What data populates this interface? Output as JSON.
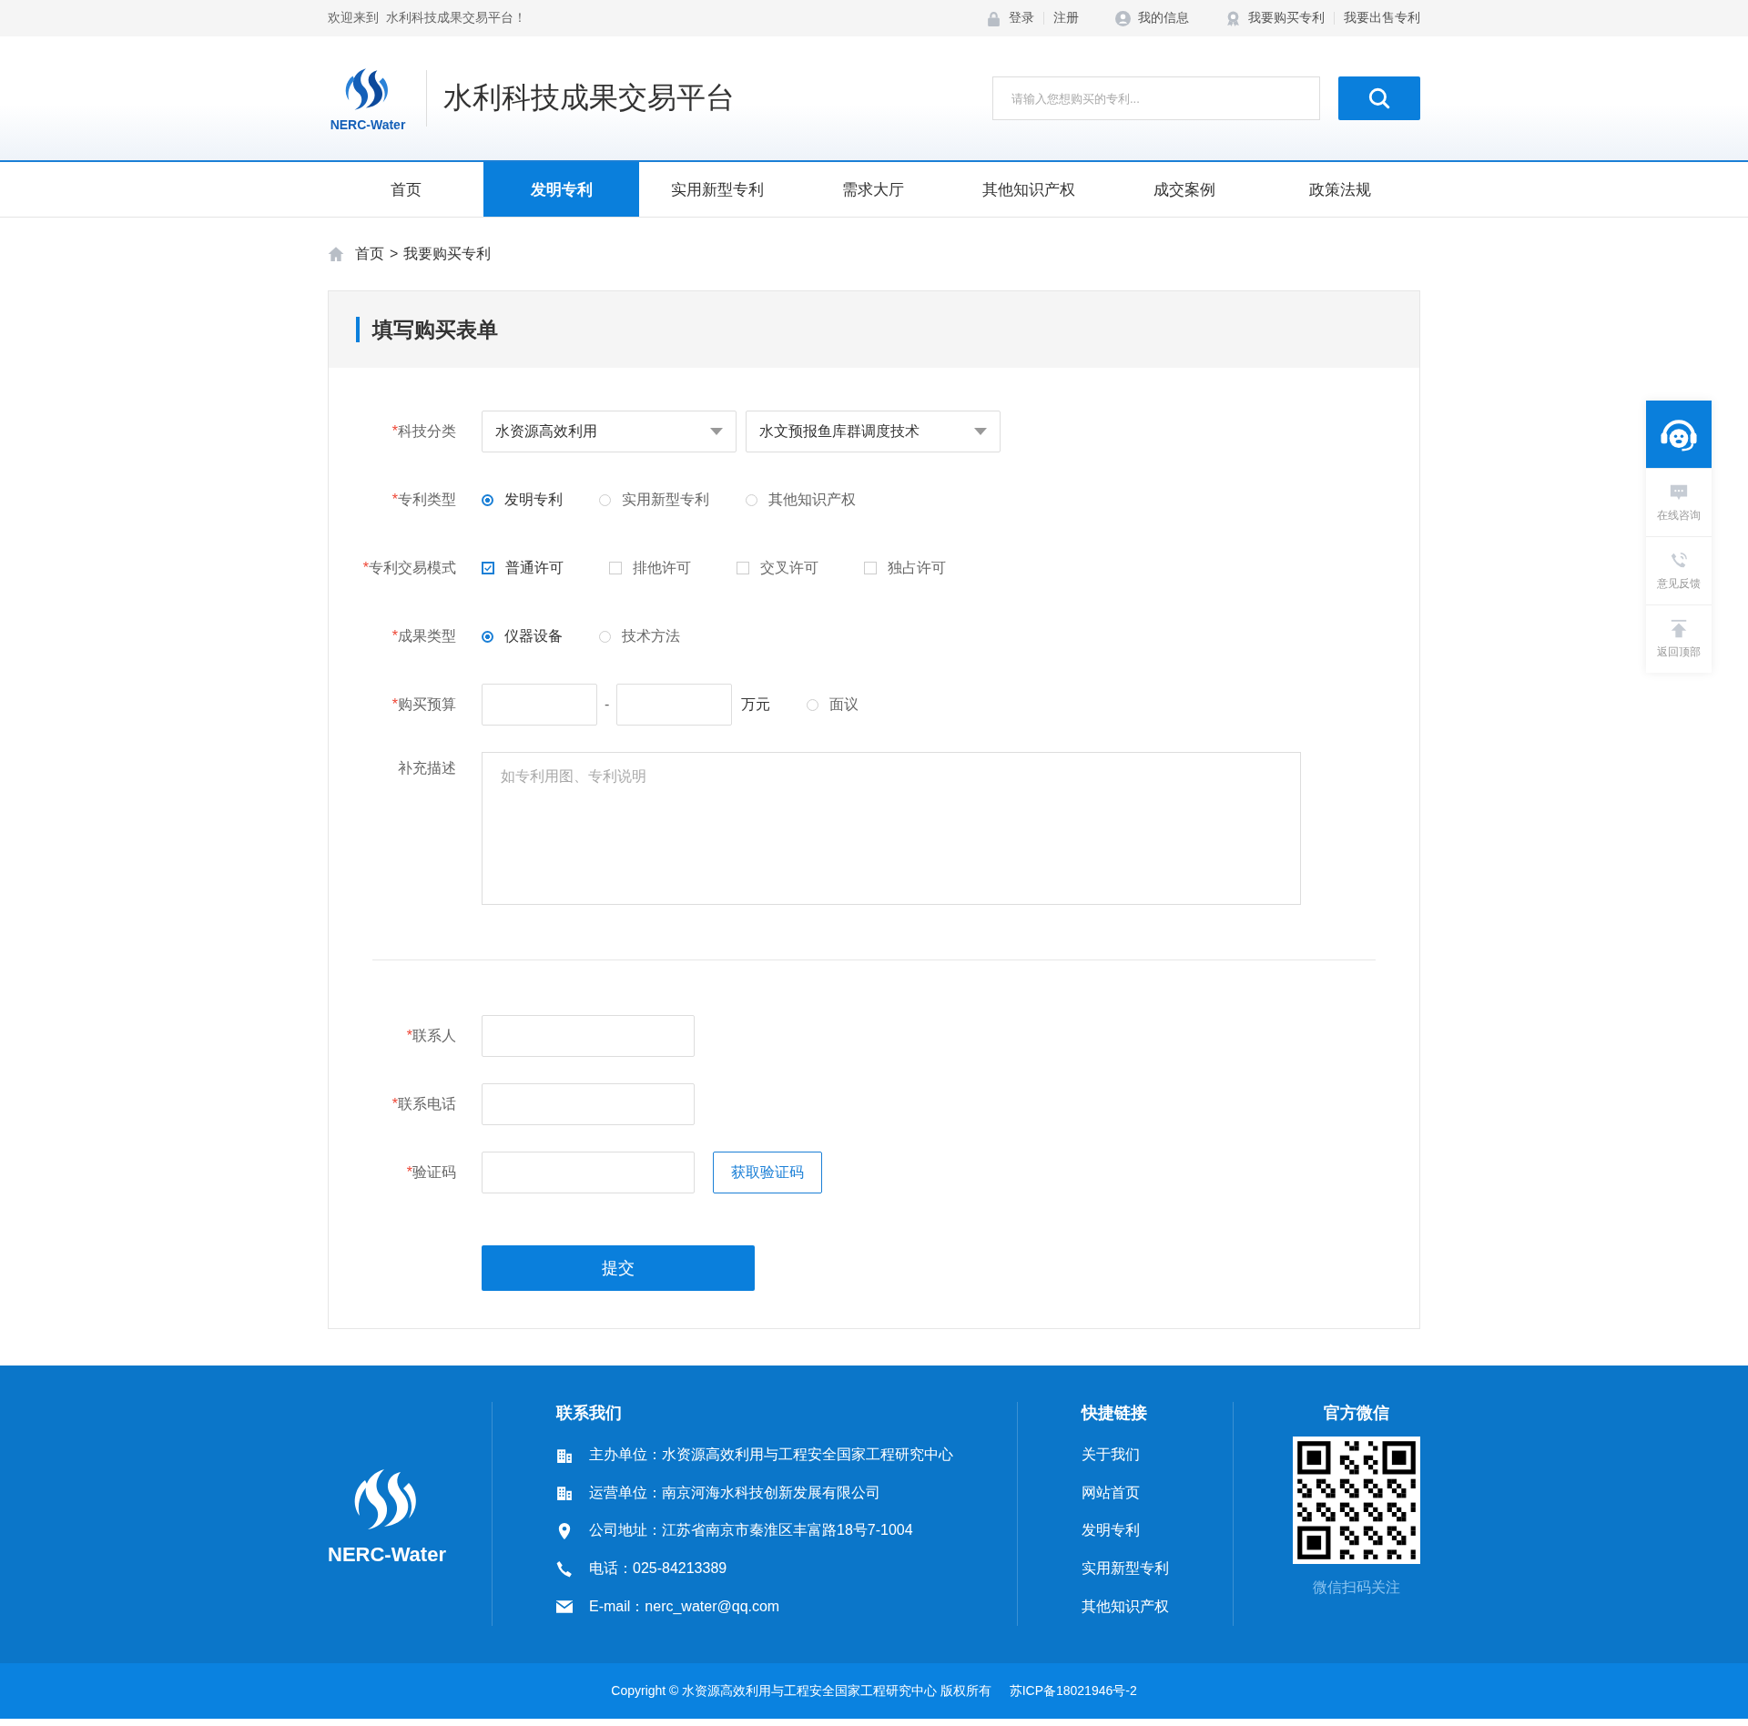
{
  "topbar": {
    "welcome": "欢迎来到  水利科技成果交易平台！",
    "links": [
      {
        "text": "登录",
        "kind": "lock"
      },
      {
        "text": "注册",
        "kind": "plain"
      },
      {
        "text": "我的信息",
        "kind": "user"
      },
      {
        "text": "我要购买专利",
        "kind": "badge"
      },
      {
        "text": "我要出售专利",
        "kind": "plain"
      }
    ]
  },
  "header": {
    "logo_text": "NERC-Water",
    "site_title": "水利科技成果交易平台",
    "search": {
      "placeholder": "请输入您想购买的专利..."
    }
  },
  "nav": {
    "items": [
      {
        "label": "首页",
        "selected": false
      },
      {
        "label": "发明专利",
        "selected": true
      },
      {
        "label": "实用新型专利",
        "selected": false
      },
      {
        "label": "需求大厅",
        "selected": false
      },
      {
        "label": "其他知识产权",
        "selected": false
      },
      {
        "label": "成交案例",
        "selected": false
      },
      {
        "label": "政策法规",
        "selected": false
      }
    ]
  },
  "breadcrumb": {
    "items": [
      "首页",
      "我要购买专利"
    ],
    "separator": ">"
  },
  "form": {
    "title": "填写购买表单",
    "fields": [
      {
        "kind": "select",
        "mark": "*",
        "label": "科技分类",
        "selects": [
          {
            "value": "水资源高效利用"
          },
          {
            "value": "水文预报鱼库群调度技术"
          }
        ]
      },
      {
        "kind": "radio",
        "mark": "*",
        "label": "专利类型",
        "options": [
          {
            "label": "发明专利",
            "selected": true
          },
          {
            "label": "实用新型专利",
            "selected": false
          },
          {
            "label": "其他知识产权",
            "selected": false
          }
        ]
      },
      {
        "kind": "checkbox",
        "mark": "*",
        "label": "专利交易模式",
        "options": [
          {
            "label": "普通许可",
            "checked": true
          },
          {
            "label": "排他许可",
            "checked": false
          },
          {
            "label": "交叉许可",
            "checked": false
          },
          {
            "label": "独占许可",
            "checked": false
          }
        ]
      },
      {
        "kind": "radio",
        "mark": "*",
        "label": "成果类型",
        "options": [
          {
            "label": "仪器设备",
            "selected": true
          },
          {
            "label": "技术方法",
            "selected": false
          }
        ]
      },
      {
        "kind": "budget",
        "mark": "*",
        "label": "购买预算",
        "separator": "-",
        "unit": "万元",
        "options": [
          {
            "label": "面议",
            "selected": false
          }
        ]
      },
      {
        "kind": "textarea",
        "label": "补充描述",
        "placeholder": "如专利用图、专利说明"
      }
    ],
    "contact_fields": [
      {
        "kind": "text",
        "mark": "*",
        "label": "联系人"
      },
      {
        "kind": "text",
        "mark": "*",
        "label": "联系电话"
      },
      {
        "kind": "code",
        "mark": "*",
        "label": "验证码",
        "button": "获取验证码"
      }
    ],
    "submit": "提交"
  },
  "side_widget": {
    "items": [
      {
        "kind": "support"
      },
      {
        "kind": "chat",
        "label": "在线咨询"
      },
      {
        "kind": "phone",
        "label": "意见反馈"
      },
      {
        "kind": "top",
        "label": "返回顶部"
      }
    ]
  },
  "footer": {
    "logo_text": "NERC-Water",
    "contact": {
      "title": "联系我们",
      "items": [
        {
          "kind": "building",
          "text": "主办单位：水资源高效利用与工程安全国家工程研究中心"
        },
        {
          "kind": "building",
          "text": "运营单位：南京河海水科技创新发展有限公司"
        },
        {
          "kind": "pin",
          "text": "公司地址：江苏省南京市秦淮区丰富路18号7-1004"
        },
        {
          "kind": "phone",
          "text": "电话：025-84213389"
        },
        {
          "kind": "mail",
          "text": "E-mail：nerc_water@qq.com"
        }
      ]
    },
    "links": {
      "title": "快捷链接",
      "items": [
        "关于我们",
        "网站首页",
        "发明专利",
        "实用新型专利",
        "其他知识产权"
      ]
    },
    "wechat": {
      "title": "官方微信",
      "caption": "微信扫码关注"
    },
    "copyright": "Copyright © 水资源高效利用与工程安全国家工程研究中心 版权所有     苏ICP备18021946号-2"
  }
}
